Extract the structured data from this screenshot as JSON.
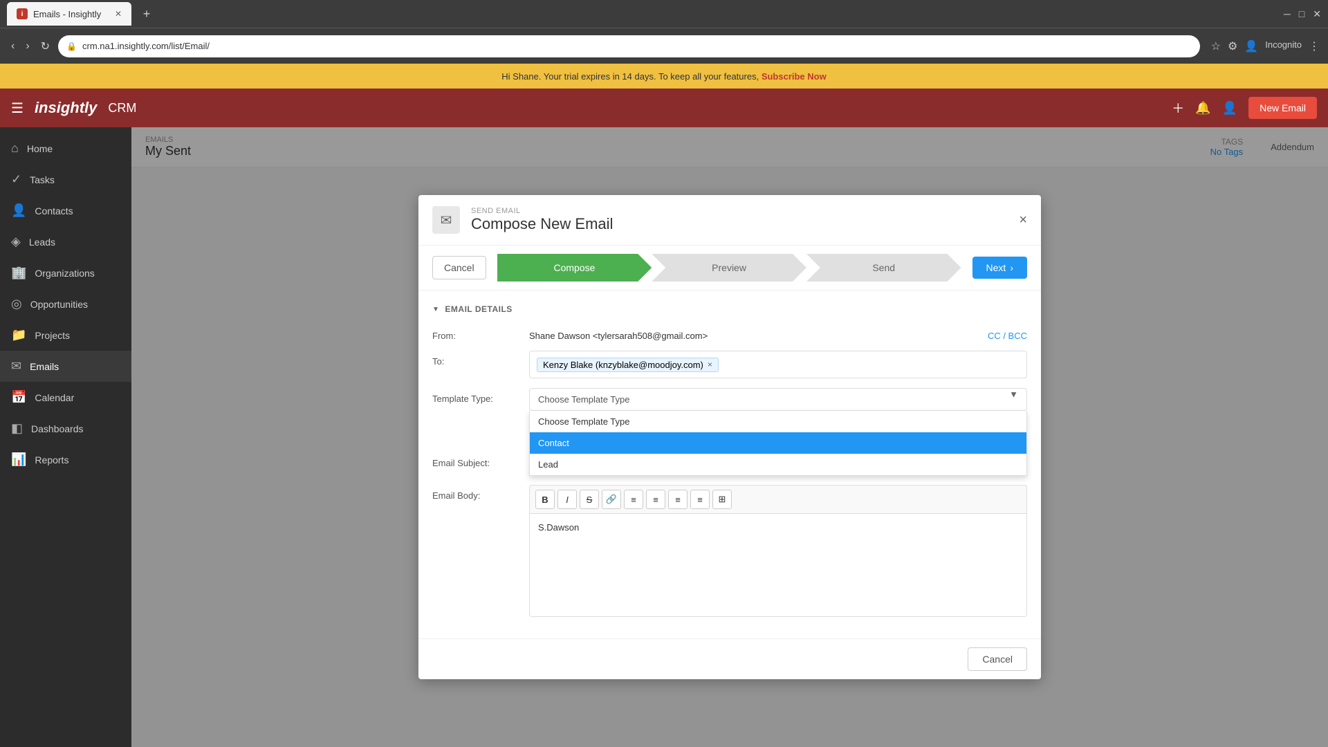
{
  "browser": {
    "tab_title": "Emails - Insightly",
    "url": "crm.na1.insightly.com/list/Email/",
    "new_tab_label": "+",
    "incognito_label": "Incognito"
  },
  "trial_banner": {
    "text": "Hi Shane. Your trial expires in 14 days. To keep all your features,",
    "link_text": "Subscribe Now"
  },
  "app_header": {
    "logo": "insightly",
    "crm": "CRM",
    "new_email_btn": "New Email"
  },
  "sidebar": {
    "items": [
      {
        "label": "Home",
        "icon": "⌂"
      },
      {
        "label": "Tasks",
        "icon": "✓"
      },
      {
        "label": "Contacts",
        "icon": "👤"
      },
      {
        "label": "Leads",
        "icon": "◈"
      },
      {
        "label": "Organizations",
        "icon": "🏢"
      },
      {
        "label": "Opportunities",
        "icon": "◎"
      },
      {
        "label": "Projects",
        "icon": "📁"
      },
      {
        "label": "Emails",
        "icon": "✉"
      },
      {
        "label": "Calendar",
        "icon": "📅"
      },
      {
        "label": "Dashboards",
        "icon": "◧"
      },
      {
        "label": "Reports",
        "icon": "📊"
      }
    ]
  },
  "emails_page": {
    "section": "EMAILS",
    "title": "My Sent",
    "tags_label": "No Tags",
    "addendum_label": "Addendum"
  },
  "modal": {
    "subtitle": "SEND EMAIL",
    "title": "Compose New Email",
    "close_btn": "×",
    "cancel_btn": "Cancel",
    "next_btn": "Next",
    "steps": [
      {
        "label": "Compose",
        "active": true
      },
      {
        "label": "Preview",
        "active": false
      },
      {
        "label": "Send",
        "active": false
      }
    ],
    "section_label": "EMAIL DETAILS",
    "from_label": "From:",
    "from_value": "Shane Dawson <tylersarah508@gmail.com>",
    "cc_bcc": "CC / BCC",
    "to_label": "To:",
    "recipient": "Kenzy Blake (knzyblake@moodjoy.com)",
    "recipient_remove": "×",
    "template_type_label": "Template Type:",
    "template_type_placeholder": "Choose Template Type",
    "template_options": [
      {
        "label": "Choose Template Type",
        "value": "",
        "selected": false
      },
      {
        "label": "Contact",
        "value": "contact",
        "selected": true
      },
      {
        "label": "Lead",
        "value": "lead",
        "selected": false
      }
    ],
    "email_subject_label": "Email Subject:",
    "email_body_label": "Email Body:",
    "toolbar_buttons": [
      "B",
      "I",
      "S",
      "🔗",
      "≡",
      "≡",
      "≡",
      "≡",
      "⊞"
    ],
    "body_content": "S.Dawson",
    "footer_cancel": "Cancel"
  }
}
